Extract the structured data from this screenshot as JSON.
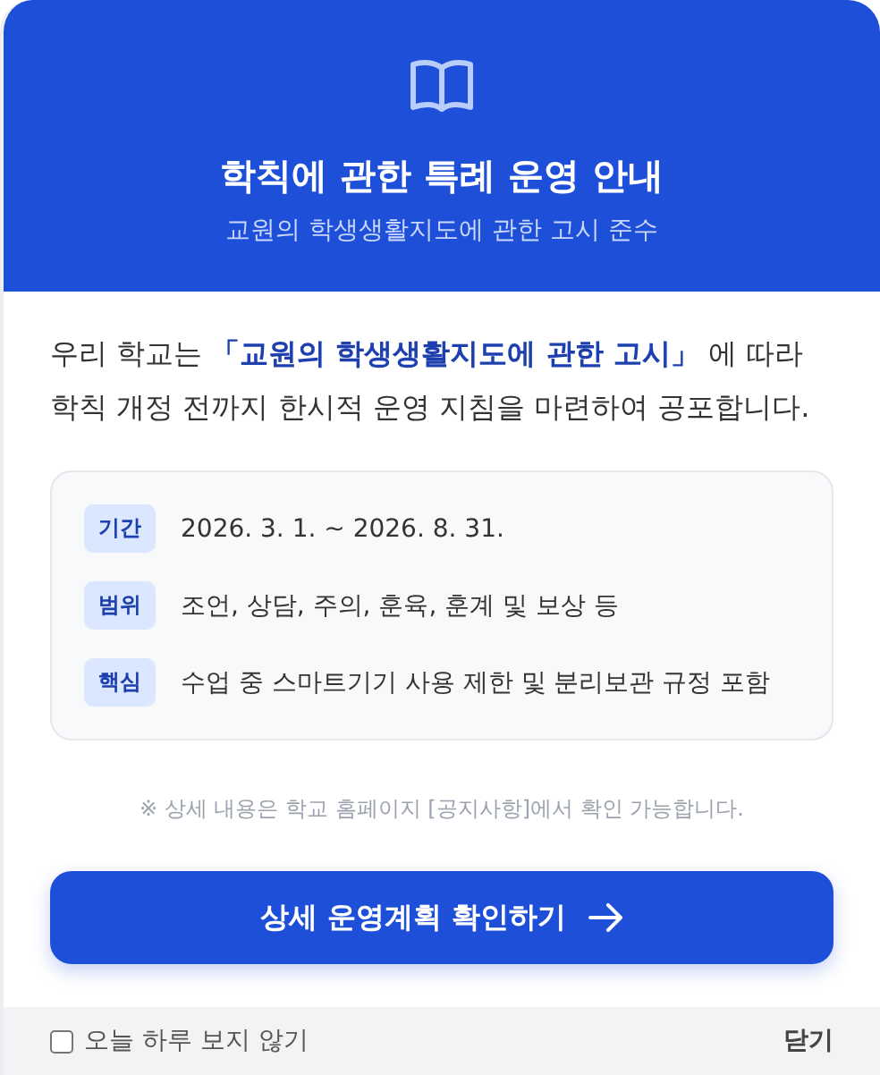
{
  "header": {
    "title": "학칙에 관한 특례 운영 안내",
    "subtitle": "교원의 학생생활지도에 관한 고시 준수"
  },
  "intro": "우리 학교는 **「교원의 학생생활지도에 관한 고시」** 에 따라 학칙 개정 전까지 한시적 운영 지침을 마련하여 공포합니다.",
  "details": [
    {
      "label": "기간",
      "value": "2026. 3. 1. ~ 2026. 8. 31."
    },
    {
      "label": "범위",
      "value": "조언, 상담, 주의, 훈육, 훈계 및 보상 등"
    },
    {
      "label": "핵심",
      "value": "수업 중 스마트기기 사용 제한 및 분리보관 규정 포함"
    }
  ],
  "note": "※ 상세 내용은 학교 홈페이지 [공지사항]에서 확인 가능합니다.",
  "button": {
    "label": "상세 운영계획 확인하기"
  },
  "footer": {
    "checkbox": {
      "label": "오늘 하루 보지 않기",
      "checked": false
    },
    "close": "닫기"
  }
}
